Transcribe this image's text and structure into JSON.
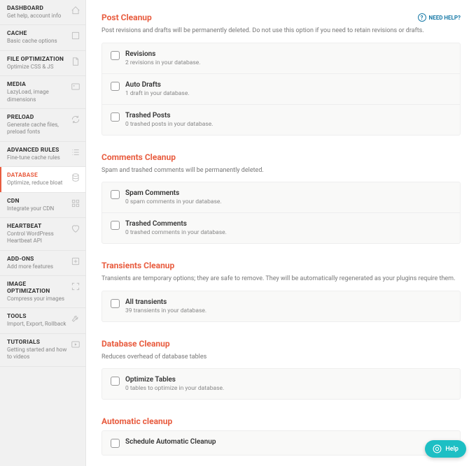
{
  "sidebar": [
    {
      "title": "DASHBOARD",
      "desc": "Get help, account info",
      "icon": "home"
    },
    {
      "title": "CACHE",
      "desc": "Basic cache options",
      "icon": "square"
    },
    {
      "title": "FILE OPTIMIZATION",
      "desc": "Optimize CSS & JS",
      "icon": "file"
    },
    {
      "title": "MEDIA",
      "desc": "LazyLoad, image dimensions",
      "icon": "image"
    },
    {
      "title": "PRELOAD",
      "desc": "Generate cache files, preload fonts",
      "icon": "refresh"
    },
    {
      "title": "ADVANCED RULES",
      "desc": "Fine-tune cache rules",
      "icon": "list"
    },
    {
      "title": "DATABASE",
      "desc": "Optimize, reduce bloat",
      "icon": "database",
      "active": true
    },
    {
      "title": "CDN",
      "desc": "Integrate your CDN",
      "icon": "grid"
    },
    {
      "title": "HEARTBEAT",
      "desc": "Control WordPress Heartbeat API",
      "icon": "heart"
    },
    {
      "title": "ADD-ONS",
      "desc": "Add more features",
      "icon": "addon"
    },
    {
      "title": "IMAGE OPTIMIZATION",
      "desc": "Compress your images",
      "icon": "compress"
    },
    {
      "title": "TOOLS",
      "desc": "Import, Export, Rollback",
      "icon": "tool"
    },
    {
      "title": "TUTORIALS",
      "desc": "Getting started and how to videos",
      "icon": "play"
    }
  ],
  "help_label": "NEED HELP?",
  "sections": [
    {
      "title": "Post Cleanup",
      "desc": "Post revisions and drafts will be permanently deleted. Do not use this option if you need to retain revisions or drafts.",
      "showHelp": true,
      "opts": [
        {
          "title": "Revisions",
          "desc": "2 revisions in your database."
        },
        {
          "title": "Auto Drafts",
          "desc": "1 draft in your database."
        },
        {
          "title": "Trashed Posts",
          "desc": "0 trashed posts in your database."
        }
      ]
    },
    {
      "title": "Comments Cleanup",
      "desc": "Spam and trashed comments will be permanently deleted.",
      "opts": [
        {
          "title": "Spam Comments",
          "desc": "0 spam comments in your database."
        },
        {
          "title": "Trashed Comments",
          "desc": "0 trashed comments in your database."
        }
      ]
    },
    {
      "title": "Transients Cleanup",
      "desc": "Transients are temporary options; they are safe to remove. They will be automatically regenerated as your plugins require them.",
      "opts": [
        {
          "title": "All transients",
          "desc": "39 transients in your database."
        }
      ]
    },
    {
      "title": "Database Cleanup",
      "desc": "Reduces overhead of database tables",
      "opts": [
        {
          "title": "Optimize Tables",
          "desc": "0 tables to optimize in your database."
        }
      ]
    },
    {
      "title": "Automatic cleanup",
      "desc": "",
      "opts": [
        {
          "title": "Schedule Automatic Cleanup",
          "desc": ""
        }
      ]
    }
  ],
  "fab_label": "Help"
}
